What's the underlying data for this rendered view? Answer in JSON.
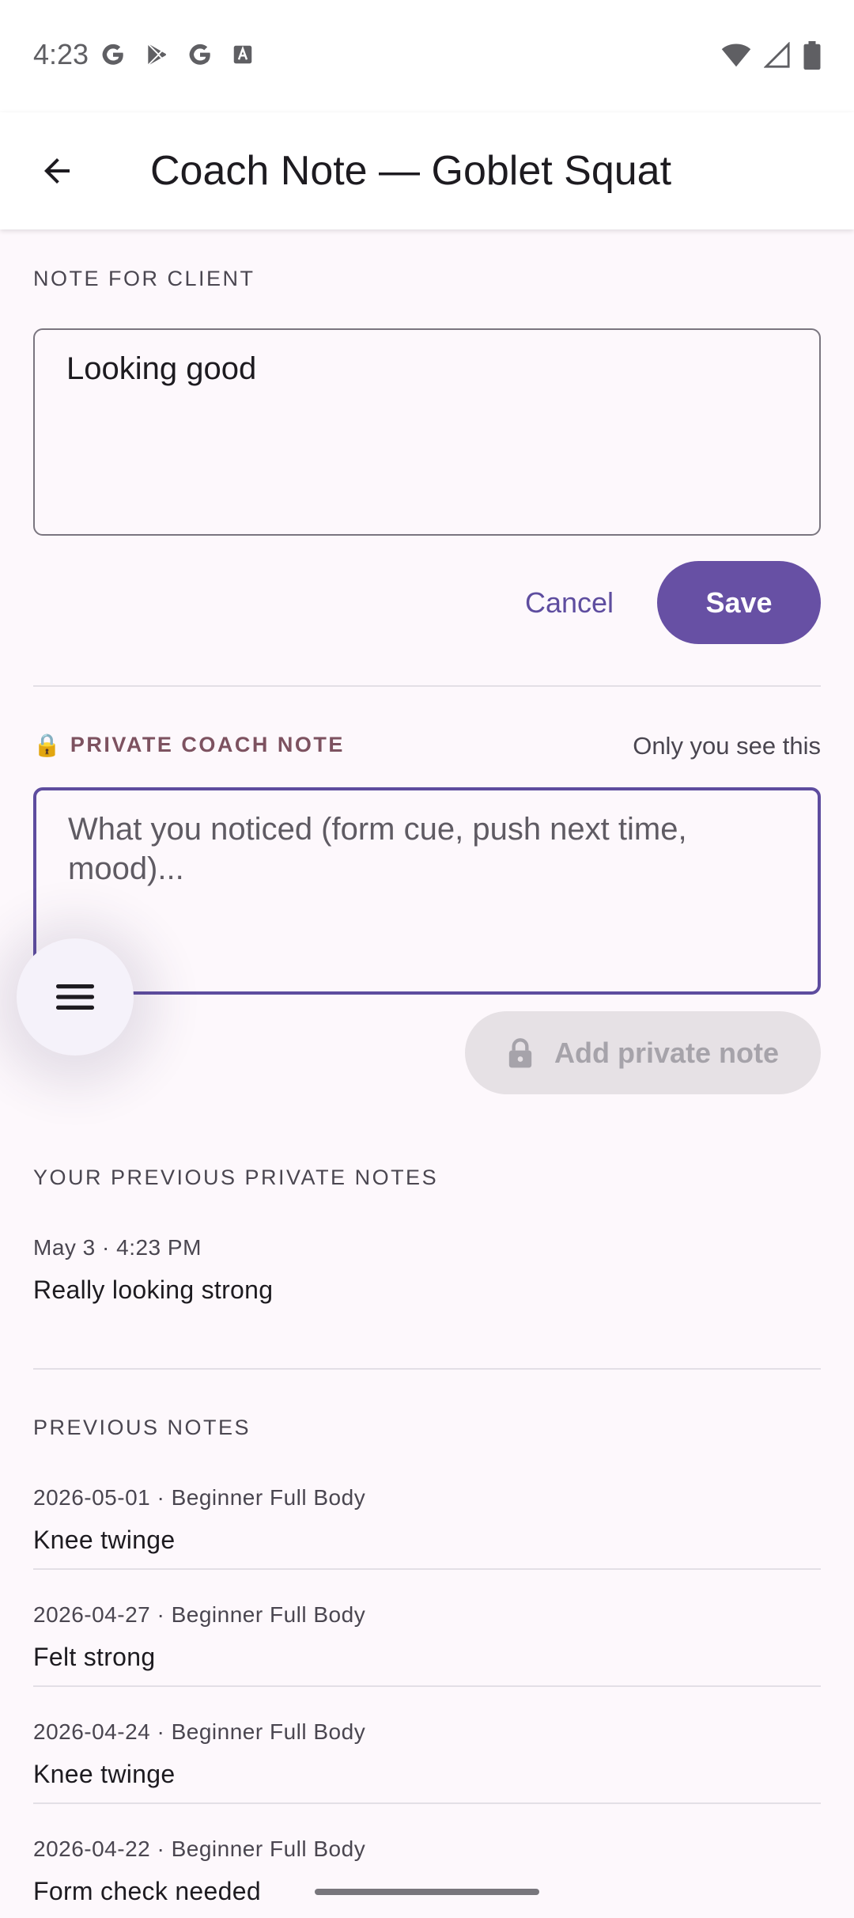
{
  "status_bar": {
    "time": "4:23",
    "left_icons": [
      "google-g-icon",
      "play-store-icon",
      "google-g-icon",
      "font-a-icon"
    ],
    "right_icons": [
      "wifi-icon",
      "signal-icon",
      "battery-icon"
    ]
  },
  "app_bar": {
    "back_icon": "arrow-back-icon",
    "title": "Coach Note — Goblet Squat"
  },
  "client_note": {
    "section_label": "NOTE FOR CLIENT",
    "value": "Looking good",
    "cancel_label": "Cancel",
    "save_label": "Save"
  },
  "private_note": {
    "lock_icon": "🔒",
    "section_label": "PRIVATE COACH NOTE",
    "hint": "Only you see this",
    "placeholder": "What you noticed (form cue, push next time, mood)...",
    "add_label": "Add private note"
  },
  "previous_private": {
    "section_label": "YOUR PREVIOUS PRIVATE NOTES",
    "items": [
      {
        "date": "May 3 · 4:23 PM",
        "body": "Really looking strong"
      }
    ]
  },
  "previous_notes": {
    "section_label": "PREVIOUS NOTES",
    "items": [
      {
        "date": "2026-05-01 · Beginner Full Body",
        "body": "Knee twinge"
      },
      {
        "date": "2026-04-27 · Beginner Full Body",
        "body": "Felt strong"
      },
      {
        "date": "2026-04-24 · Beginner Full Body",
        "body": "Knee twinge"
      },
      {
        "date": "2026-04-22 · Beginner Full Body",
        "body": "Form check needed"
      }
    ]
  },
  "colors": {
    "primary": "#6750a4",
    "private_accent": "#7d5260",
    "background": "#fdf8fc"
  }
}
